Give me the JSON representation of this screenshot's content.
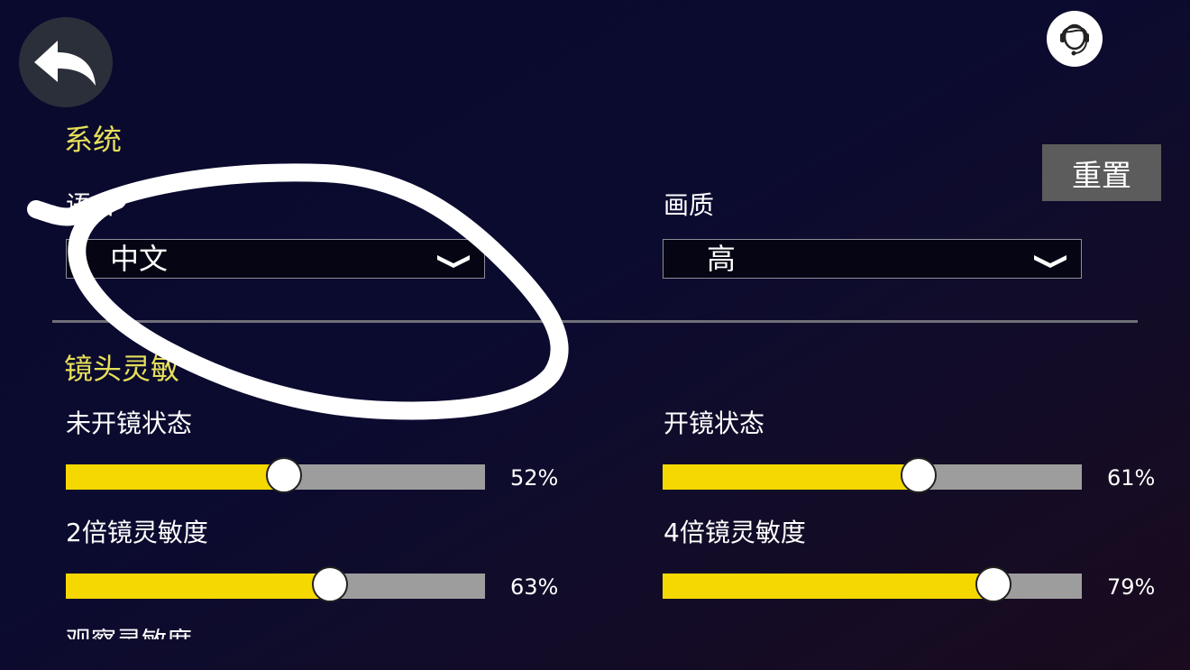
{
  "system": {
    "title": "系统",
    "language": {
      "label": "语言",
      "value": "中文"
    },
    "quality": {
      "label": "画质",
      "value": "高"
    },
    "reset_label": "重置"
  },
  "camera": {
    "title": "镜头灵敏",
    "sliders": [
      {
        "label": "未开镜状态",
        "value": 52,
        "display": "52%"
      },
      {
        "label": "开镜状态",
        "value": 61,
        "display": "61%"
      },
      {
        "label": "2倍镜灵敏度",
        "value": 63,
        "display": "63%"
      },
      {
        "label": "4倍镜灵敏度",
        "value": 79,
        "display": "79%"
      }
    ],
    "cut_off_label": "观察灵敏度"
  },
  "icons": {
    "back": "back-arrow-icon",
    "support": "customer-support-icon",
    "dropdown": "chevron-down-icon"
  },
  "colors": {
    "accent_title": "#e8df5a",
    "slider_fill": "#f5d800",
    "slider_track": "#9d9d9d",
    "reset_bg": "#5c5c5c"
  }
}
